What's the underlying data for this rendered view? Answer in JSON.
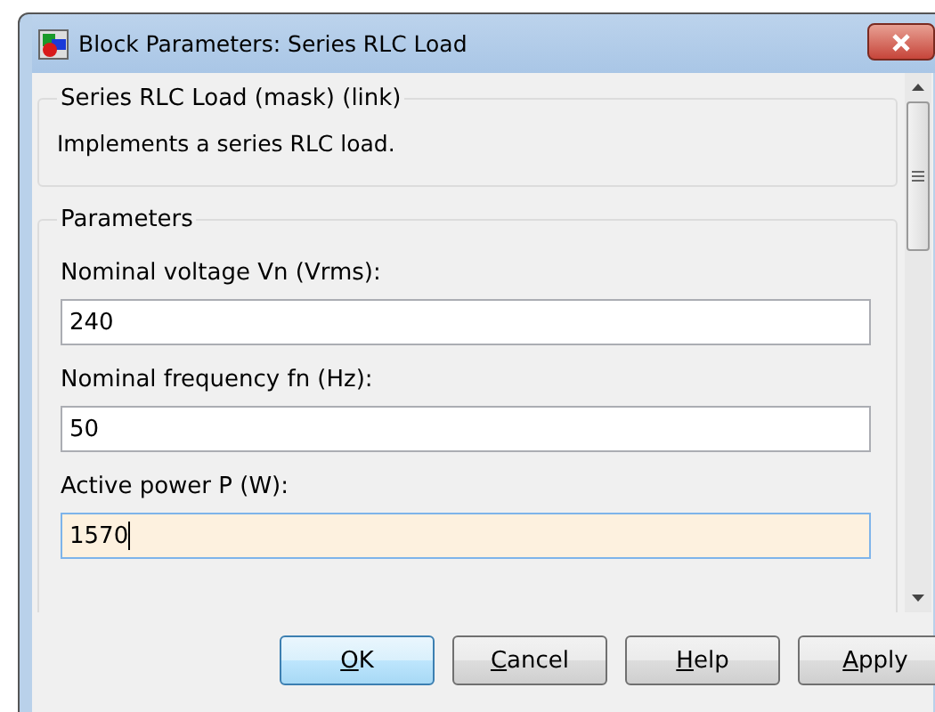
{
  "window": {
    "title": "Block Parameters: Series RLC Load"
  },
  "mask_group": {
    "title": "Series RLC Load (mask) (link)",
    "description": "Implements a series RLC load."
  },
  "parameters": {
    "title": "Parameters",
    "fields": [
      {
        "label": "Nominal voltage Vn (Vrms):",
        "value": "240",
        "focused": false
      },
      {
        "label": "Nominal frequency fn (Hz):",
        "value": "50",
        "focused": false
      },
      {
        "label": "Active power P (W):",
        "value": "1570",
        "focused": true
      }
    ]
  },
  "buttons": [
    {
      "label": "OK",
      "default": true
    },
    {
      "label": "Cancel",
      "default": false
    },
    {
      "label": "Help",
      "default": false
    },
    {
      "label": "Apply",
      "default": false
    }
  ]
}
